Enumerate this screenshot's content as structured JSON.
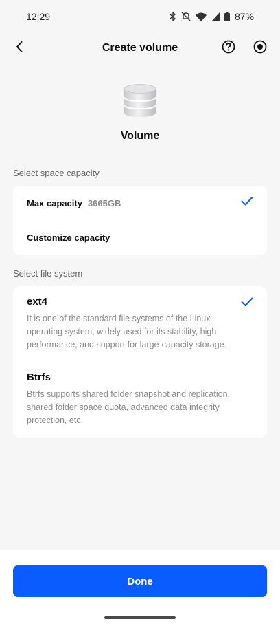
{
  "status_bar": {
    "time": "12:29",
    "battery": "87%"
  },
  "app_bar": {
    "title": "Create volume"
  },
  "hero": {
    "title": "Volume"
  },
  "capacity_section": {
    "label": "Select space capacity",
    "options": [
      {
        "title": "Max capacity",
        "value": "3665GB",
        "selected": true
      },
      {
        "title": "Customize capacity",
        "value": "",
        "selected": false
      }
    ]
  },
  "filesystem_section": {
    "label": "Select file system",
    "options": [
      {
        "title": "ext4",
        "description": "It is one of the standard file systems of the Linux operating system, widely used for its stability, high performance, and support for large-capacity storage.",
        "selected": true
      },
      {
        "title": "Btrfs",
        "description": "Btrfs supports shared folder snapshot and replication, shared folder space quota, advanced data integrity protection, etc.",
        "selected": false
      }
    ]
  },
  "footer": {
    "done_label": "Done"
  },
  "colors": {
    "accent": "#0a5cff",
    "background": "#f6f6f7",
    "card": "#ffffff",
    "muted_text": "#8a8a8a"
  },
  "icons": {
    "bluetooth": "bluetooth-icon",
    "mute": "mute-icon",
    "wifi": "wifi-icon",
    "signal": "signal-icon",
    "battery": "battery-icon",
    "back": "chevron-left-icon",
    "help": "help-icon",
    "record": "record-icon",
    "hero": "database-icon",
    "check": "check-icon"
  }
}
